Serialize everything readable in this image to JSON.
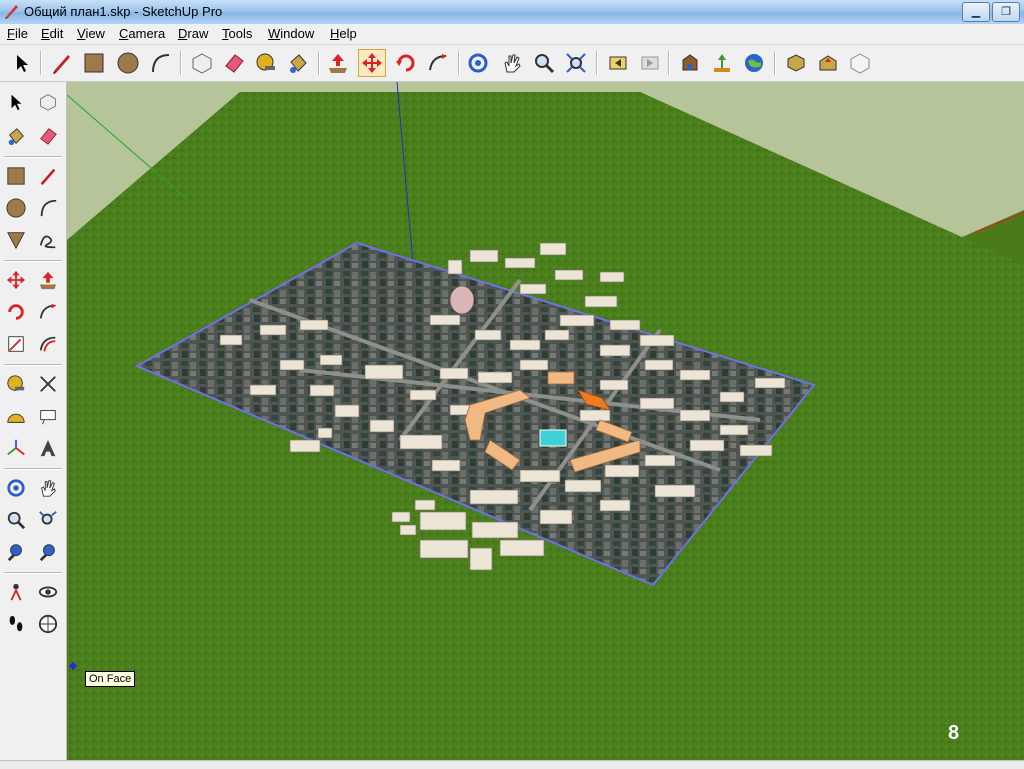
{
  "window": {
    "title": "Общий план1.skp - SketchUp Pro",
    "minimize_glyph": "▁",
    "restore_glyph": "❐"
  },
  "menu": [
    "File",
    "Edit",
    "View",
    "Camera",
    "Draw",
    "Tools",
    "Window",
    "Help"
  ],
  "toolbar": {
    "groups": [
      [
        "select-icon"
      ],
      [
        "line-icon",
        "rectangle-icon",
        "circle-icon",
        "arc-icon"
      ],
      [
        "make-component-icon",
        "eraser-icon",
        "tape-measure-icon",
        "paint-bucket-icon"
      ],
      [
        "push-pull-icon",
        "move-icon",
        "rotate-icon",
        "follow-me-icon"
      ],
      [
        "orbit-icon",
        "pan-icon",
        "zoom-icon",
        "zoom-extents-icon"
      ],
      [
        "previous-view-icon",
        "next-view-icon"
      ],
      [
        "get-models-icon",
        "share-model-icon",
        "google-earth-icon"
      ],
      [
        "components-icon",
        "import-model-icon",
        "component-window-icon"
      ]
    ]
  },
  "sidebar": {
    "rows": [
      [
        "select-icon",
        "make-component-icon"
      ],
      [
        "paint-bucket-icon",
        "eraser-icon"
      ],
      [
        "rectangle-icon",
        "line-icon"
      ],
      [
        "circle-icon",
        "arc-icon"
      ],
      [
        "polygon-icon",
        "freehand-icon"
      ],
      [
        "move-icon",
        "push-pull-icon"
      ],
      [
        "rotate-icon",
        "follow-me-icon"
      ],
      [
        "scale-icon",
        "offset-icon"
      ],
      [
        "tape-measure-icon",
        "dimension-icon"
      ],
      [
        "protractor-icon",
        "text-icon"
      ],
      [
        "axes-icon",
        "3d-text-icon"
      ],
      [
        "orbit-icon",
        "pan-icon"
      ],
      [
        "zoom-icon",
        "zoom-window-icon"
      ],
      [
        "zoom-extents-icon",
        "previous-view-icon"
      ],
      [
        "position-camera-icon",
        "look-around-icon"
      ],
      [
        "walk-icon",
        "section-plane-icon"
      ]
    ]
  },
  "viewport": {
    "inference_tooltip": "On Face"
  },
  "colors": {
    "ground": "#4a7d1b",
    "sky": "#b6c49a",
    "accent": "#6d71e6"
  },
  "slide_number": "8"
}
